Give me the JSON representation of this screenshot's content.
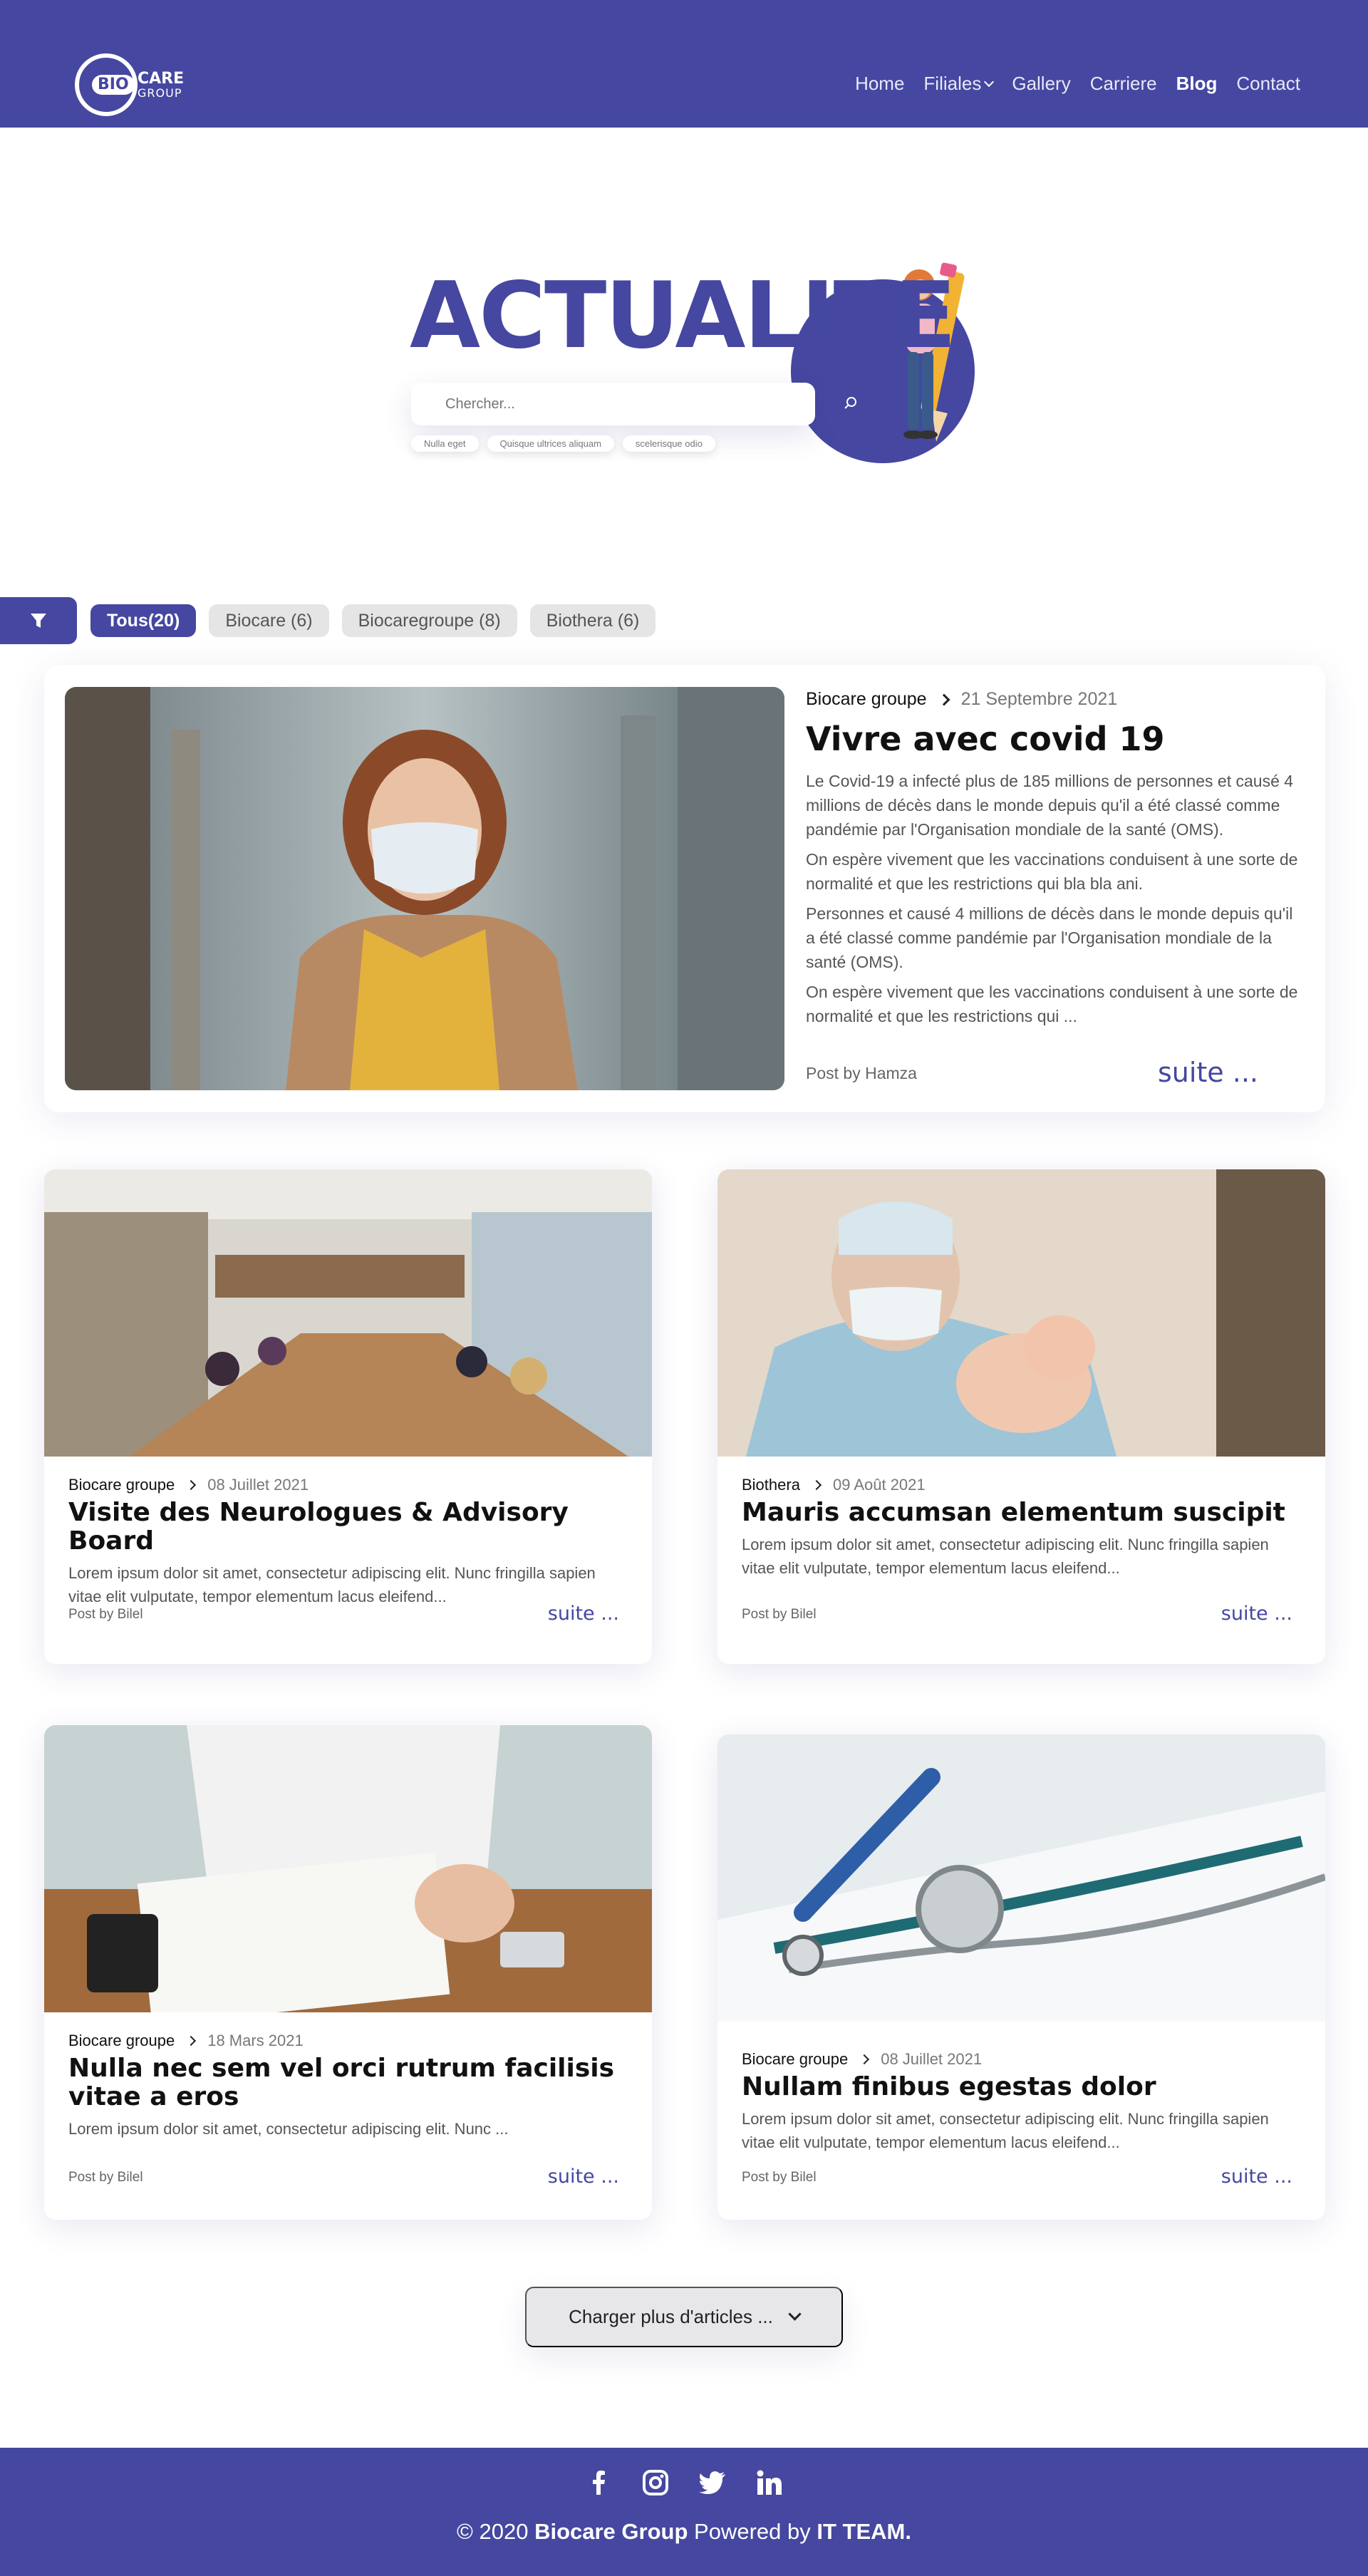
{
  "header": {
    "logo": {
      "bio": "BIO",
      "care": "CARE",
      "group": "GROUP"
    },
    "nav": [
      {
        "label": "Home"
      },
      {
        "label": "Filiales"
      },
      {
        "label": "Gallery"
      },
      {
        "label": "Carriere"
      },
      {
        "label": "Blog"
      },
      {
        "label": "Contact"
      }
    ]
  },
  "hero": {
    "title": "ACTUALITE",
    "search_placeholder": "Chercher...",
    "tags": [
      "Nulla eget",
      "Quisque ultrices aliquam",
      "scelerisque odio"
    ]
  },
  "filters": [
    {
      "label": "Tous(20)"
    },
    {
      "label": "Biocare (6)"
    },
    {
      "label": "Biocaregroupe (8)"
    },
    {
      "label": "Biothera (6)"
    }
  ],
  "featured": {
    "category": "Biocare groupe",
    "date": "21 Septembre 2021",
    "title": "Vivre avec covid 19",
    "paragraphs": [
      "Le Covid-19 a infecté plus de 185 millions de personnes et causé 4 millions de décès dans le monde depuis qu'il a été classé comme pandémie par l'Organisation mondiale de la santé (OMS).",
      "On espère vivement que les vaccinations conduisent à une sorte de normalité et que les restrictions qui bla bla ani.",
      "Personnes et causé 4 millions de décès dans le monde depuis qu'il a été classé comme pandémie par l'Organisation mondiale de la santé (OMS).",
      "On espère vivement que les vaccinations conduisent à une sorte de normalité et que les restrictions qui ..."
    ],
    "post_by": "Post by Hamza",
    "more": "suite ..."
  },
  "cards": [
    {
      "category": "Biocare groupe",
      "date": "08 Juillet 2021",
      "title": "Visite des Neurologues & Advisory Board",
      "text": "Lorem ipsum dolor sit amet, consectetur adipiscing elit. Nunc fringilla sapien vitae elit vulputate, tempor elementum lacus eleifend...",
      "post_by": "Post by Bilel",
      "more": "suite ..."
    },
    {
      "category": "Biothera",
      "date": "09 Août 2021",
      "title": "Mauris accumsan elementum suscipit",
      "text": "Lorem ipsum dolor sit amet, consectetur adipiscing elit. Nunc fringilla sapien vitae elit vulputate, tempor elementum lacus eleifend...",
      "post_by": "Post by Bilel",
      "more": "suite ..."
    },
    {
      "category": "Biocare groupe",
      "date": "18 Mars 2021",
      "title": "Nulla nec sem vel orci rutrum facilisis vitae a eros",
      "text": "Lorem ipsum dolor sit amet, consectetur adipiscing elit. Nunc ...",
      "post_by": "Post by Bilel",
      "more": "suite ..."
    },
    {
      "category": "Biocare groupe",
      "date": "08 Juillet 2021",
      "title": "Nullam finibus egestas dolor",
      "text": "Lorem ipsum dolor sit amet, consectetur adipiscing elit. Nunc fringilla sapien vitae elit vulputate, tempor elementum lacus eleifend...",
      "post_by": "Post by Bilel",
      "more": "suite ..."
    }
  ],
  "load_more": "Charger plus d'articles ...",
  "footer": {
    "copyright_prefix": "© 2020 ",
    "company": "Biocare Group",
    "powered": " Powered by ",
    "team": "IT TEAM."
  },
  "colors": {
    "brand": "#4547a0",
    "card_bg": "#ffffff",
    "chip_bg": "#e5e5e5"
  },
  "icons": [
    "filter-icon",
    "search-icon",
    "chevron-down-icon",
    "facebook-icon",
    "instagram-icon",
    "twitter-icon",
    "linkedin-icon"
  ]
}
